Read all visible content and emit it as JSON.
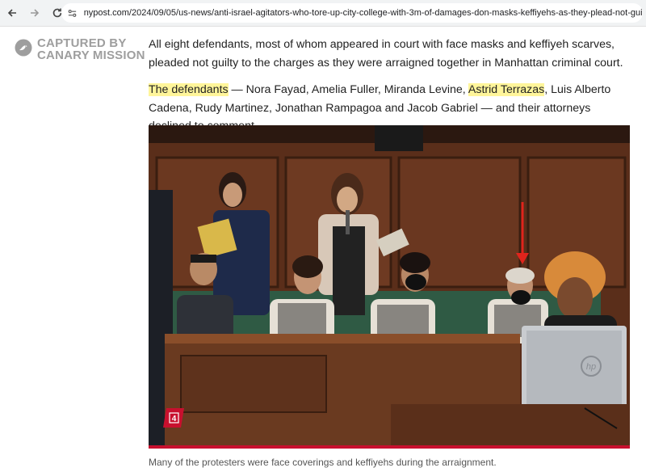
{
  "browser": {
    "url": "nypost.com/2024/09/05/us-news/anti-israel-agitators-who-tore-up-city-college-with-3m-of-damages-don-masks-keffiyehs-as-they-plead-not-guilty/",
    "back_icon": "back-arrow-icon",
    "forward_icon": "forward-arrow-icon",
    "reload_icon": "reload-icon"
  },
  "watermark": {
    "line1": "CAPTURED BY",
    "line2": "CANARY MISSION"
  },
  "article": {
    "paragraph1": "All eight defendants, most of whom appeared in court with face masks and keffiyeh scarves, pleaded not guilty to the charges as they were arraigned together in Manhattan criminal court.",
    "p2_highlight1": "The defendants",
    "p2_text1": " — Nora Fayad, Amelia Fuller, Miranda Levine, ",
    "p2_highlight2": "Astrid Terrazas",
    "p2_text2": ", Luis Alberto Cadena, Rudy Martinez, Jonathan Rampagoa and Jacob Gabriel — and their attorneys declined to comment."
  },
  "photo": {
    "gallery_number": "4",
    "laptop_logo": "hp",
    "caption": "Many of the protesters were face coverings and keffiyehs during the arraignment."
  },
  "colors": {
    "highlight": "#fff59a",
    "accent_red": "#c8102e",
    "watermark_gray": "#9e9e9e"
  }
}
